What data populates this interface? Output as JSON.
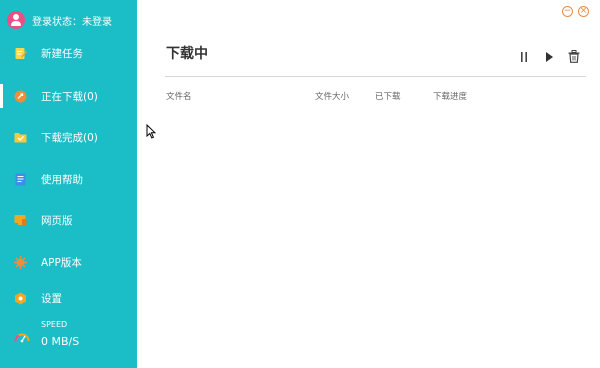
{
  "sidebar": {
    "login_status": "登录状态：未登录",
    "items": [
      {
        "label": "新建任务",
        "icon": "new-task-icon"
      },
      {
        "label": "正在下载(0)",
        "icon": "downloading-icon"
      },
      {
        "label": "下载完成(0)",
        "icon": "download-complete-icon"
      },
      {
        "label": "使用帮助",
        "icon": "help-doc-icon"
      },
      {
        "label": "网页版",
        "icon": "web-version-icon"
      },
      {
        "label": "APP版本",
        "icon": "app-version-icon"
      },
      {
        "label": "设置",
        "icon": "settings-icon"
      }
    ],
    "active_index": 1,
    "speed": {
      "label": "SPEED",
      "value": "0 MB/S"
    }
  },
  "window": {
    "minimize_glyph": "−",
    "close_glyph": "×"
  },
  "main": {
    "title": "下载中",
    "toolbar": [
      "pause-icon",
      "play-icon",
      "trash-icon"
    ],
    "table": {
      "columns": [
        "文件名",
        "文件大小",
        "已下载",
        "下载进度"
      ],
      "rows": []
    }
  },
  "colors": {
    "sidebar_bg": "#1bbdc6",
    "accent_orange": "#f08c3c",
    "avatar_pink": "#e94f86"
  }
}
